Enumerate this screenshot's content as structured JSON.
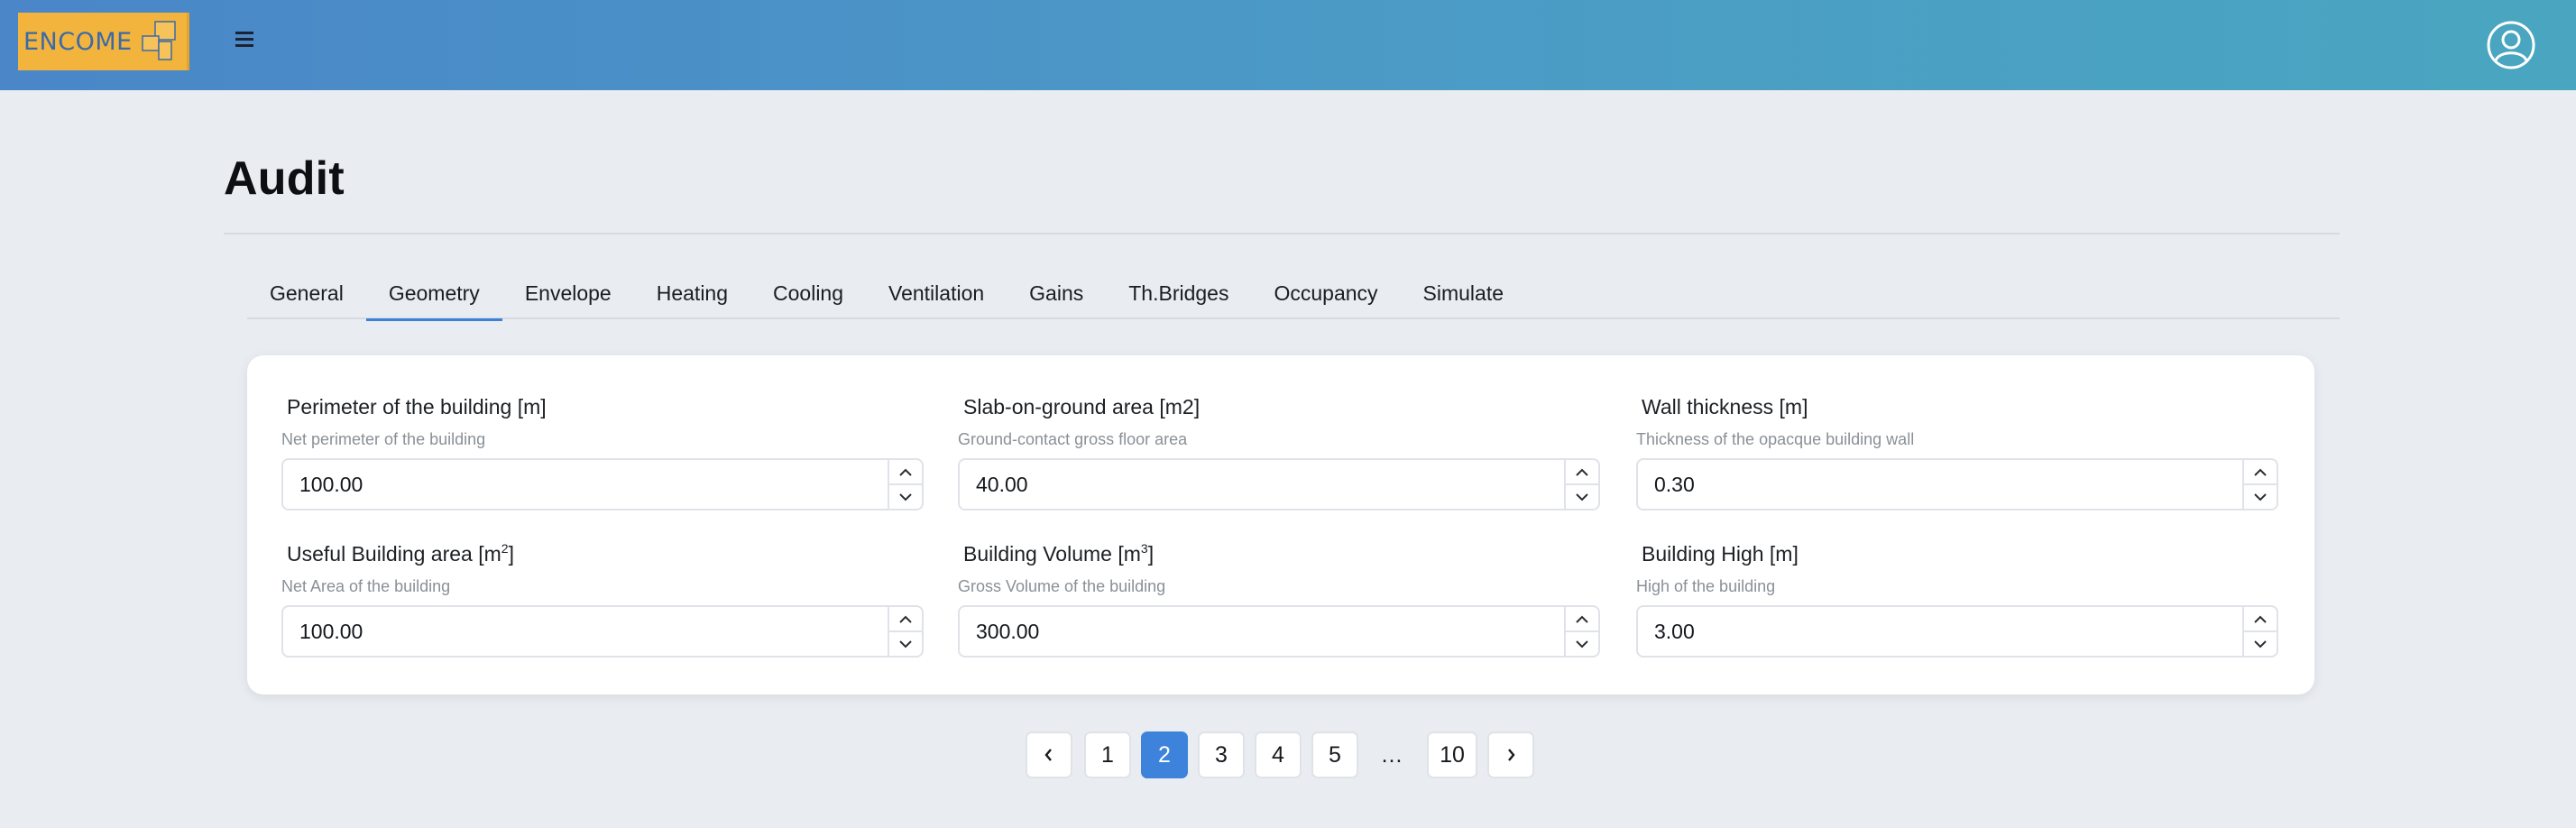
{
  "header": {
    "logo_text": "ENCOME",
    "menu_icon": "hamburger-icon",
    "user_icon": "user-circle-icon",
    "brand_colors": {
      "gradient_start": "#4a86c8",
      "gradient_end": "#4aa6c0",
      "logo_bg": "#f2b43c",
      "logo_text": "#3c6aa8"
    }
  },
  "page": {
    "title": "Audit"
  },
  "tabs": [
    {
      "label": "General",
      "active": false
    },
    {
      "label": "Geometry",
      "active": true
    },
    {
      "label": "Envelope",
      "active": false
    },
    {
      "label": "Heating",
      "active": false
    },
    {
      "label": "Cooling",
      "active": false
    },
    {
      "label": "Ventilation",
      "active": false
    },
    {
      "label": "Gains",
      "active": false
    },
    {
      "label": "Th.Bridges",
      "active": false
    },
    {
      "label": "Occupancy",
      "active": false
    },
    {
      "label": "Simulate",
      "active": false
    }
  ],
  "form": {
    "fields": [
      {
        "label": "Perimeter of the building [m]",
        "sup": "",
        "label_suffix": "",
        "help": "Net perimeter of the building",
        "value": "100.00"
      },
      {
        "label": "Slab-on-ground area [m2]",
        "sup": "",
        "label_suffix": "",
        "help": "Ground-contact gross floor area",
        "value": "40.00"
      },
      {
        "label": "Wall thickness [m]",
        "sup": "",
        "label_suffix": "",
        "help": "Thickness of the opacque building wall",
        "value": "0.30"
      },
      {
        "label": "Useful Building area [m",
        "sup": "2",
        "label_suffix": "]",
        "help": "Net Area of the building",
        "value": "100.00"
      },
      {
        "label": "Building Volume [m",
        "sup": "3",
        "label_suffix": "]",
        "help": "Gross Volume of the building",
        "value": "300.00"
      },
      {
        "label": "Building High [m]",
        "sup": "",
        "label_suffix": "",
        "help": "High of the building",
        "value": "3.00"
      }
    ]
  },
  "pagination": {
    "prev_icon": "chevron-left-icon",
    "next_icon": "chevron-right-icon",
    "pages": [
      "1",
      "2",
      "3",
      "4",
      "5",
      "…",
      "10"
    ],
    "current": "2",
    "accent": "#3d82db"
  }
}
